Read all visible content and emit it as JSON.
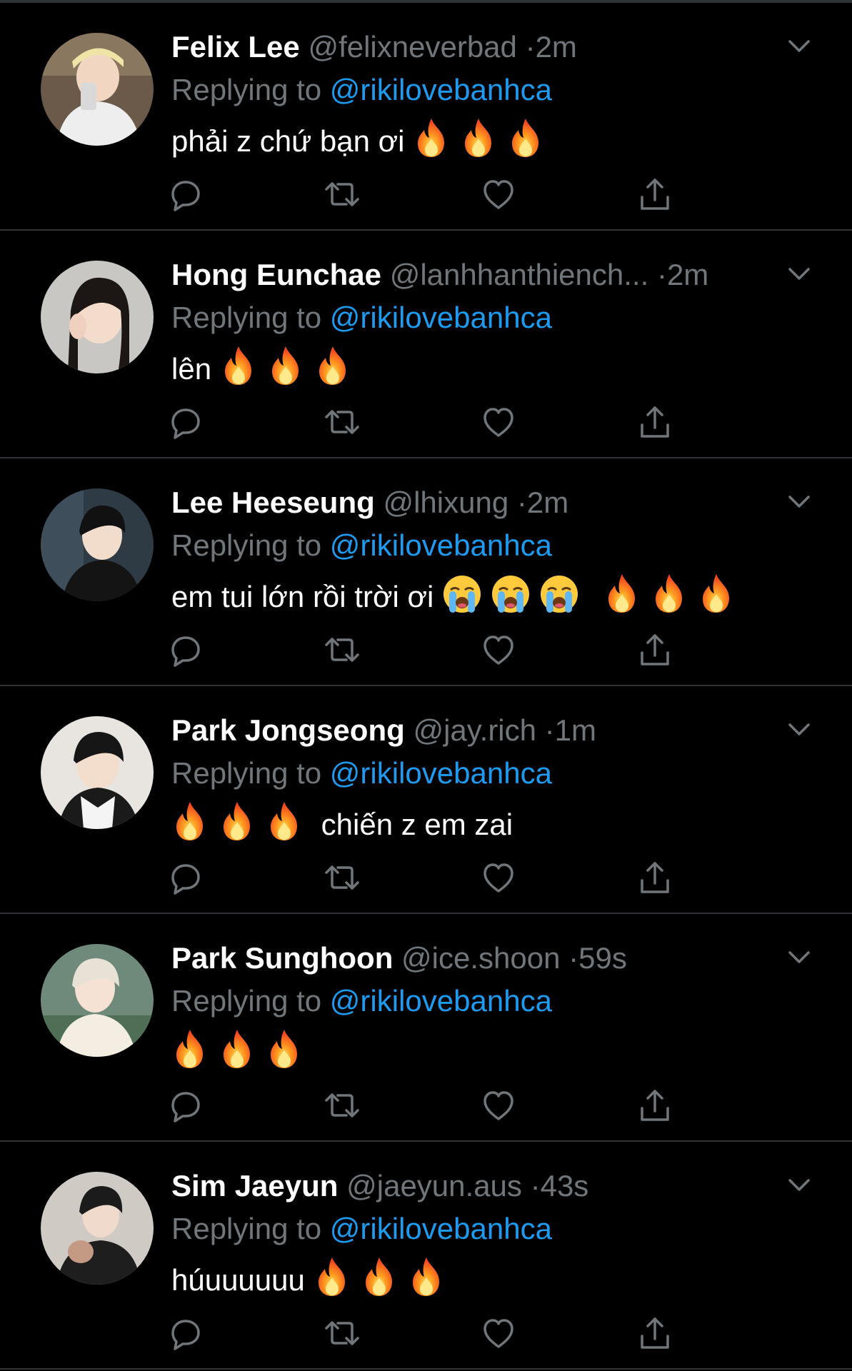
{
  "colors": {
    "background": "#000000",
    "name": "#ffffff",
    "muted": "#71767b",
    "link": "#1d9bf0",
    "divider": "#2f3336"
  },
  "replying_prefix": "Replying to",
  "replying_to": "@rikilovebanhca",
  "separator": "·",
  "tweets": [
    {
      "name": "Felix Lee",
      "handle": "@felixneverbad",
      "time": "2m",
      "text": "phải z chứ bạn ơi",
      "emoji": "flame x3 after text"
    },
    {
      "name": "Hong Eunchae",
      "handle": "@lanhhanthiench...",
      "time": "2m",
      "text": "lên",
      "emoji": "flame x3 after text"
    },
    {
      "name": "Lee Heeseung",
      "handle": "@lhixung",
      "time": "2m",
      "text": "em tui lớn rồi trời ơi",
      "emoji": "crying x3, flame x3 after text"
    },
    {
      "name": "Park Jongseong",
      "handle": "@jay.rich",
      "time": "1m",
      "text": "chiến z em zai",
      "emoji": "flame x3 before text"
    },
    {
      "name": "Park Sunghoon",
      "handle": "@ice.shoon",
      "time": "59s",
      "text": "",
      "emoji": "flame x3"
    },
    {
      "name": "Sim Jaeyun",
      "handle": "@jaeyun.aus",
      "time": "43s",
      "text": "húuuuuuu",
      "emoji": "flame x3 after text"
    }
  ],
  "action_icons": [
    "reply-icon",
    "retweet-icon",
    "like-icon",
    "share-icon"
  ]
}
